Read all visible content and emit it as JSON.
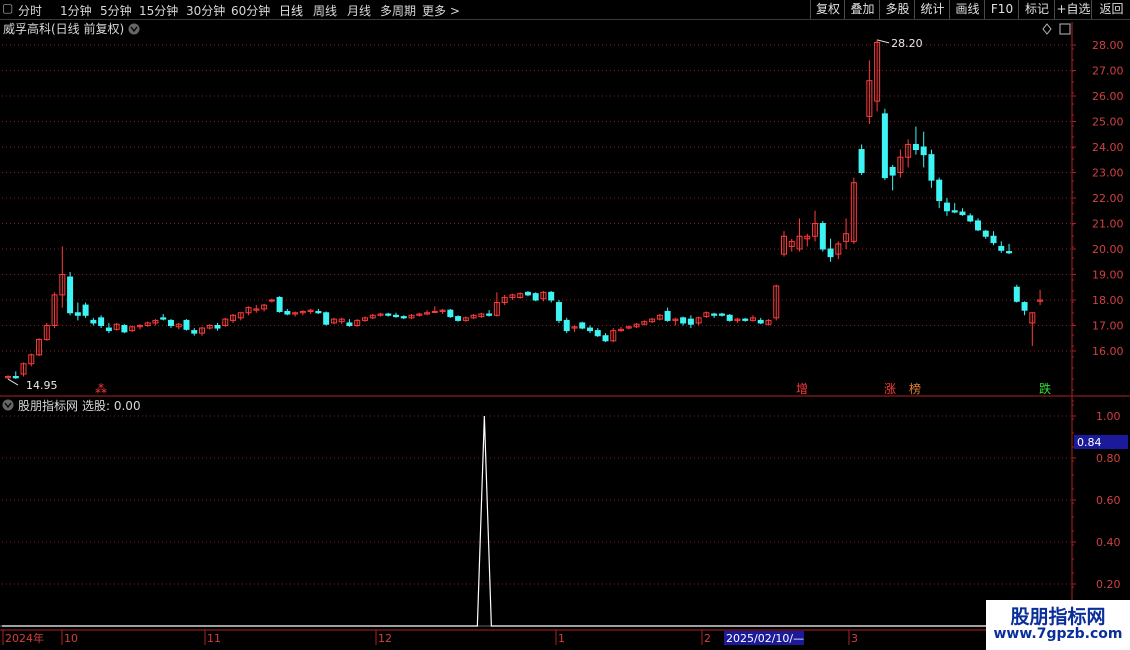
{
  "toolbar": {
    "left_items": [
      "分时",
      "1分钟",
      "5分钟",
      "15分钟",
      "30分钟",
      "60分钟",
      "日线",
      "周线",
      "月线",
      "多周期",
      "更多 >"
    ],
    "active_index": 6,
    "right_items": [
      "复权",
      "叠加",
      "多股",
      "统计",
      "画线",
      "F10",
      "标记",
      "+自选",
      "返回"
    ]
  },
  "stock": {
    "title": "威孚高科(日线 前复权)"
  },
  "indicator": {
    "title": "股朋指标网",
    "value_label": "选股: 0.00"
  },
  "price_axis": {
    "ticks": [
      "28.00",
      "27.00",
      "26.00",
      "25.00",
      "24.00",
      "23.00",
      "22.00",
      "21.00",
      "20.00",
      "19.00",
      "18.00",
      "17.00",
      "16.00"
    ]
  },
  "indicator_axis": {
    "ticks": [
      "1.00",
      "0.80",
      "0.60",
      "0.40",
      "0.20"
    ],
    "cursor_value": "0.84"
  },
  "annotations": {
    "high": "28.20",
    "low": "14.95"
  },
  "event_markers": [
    {
      "text": "⁂",
      "color": "#ff3b3b"
    },
    {
      "text": "增",
      "color": "#ff3b3b"
    },
    {
      "text": "涨",
      "color": "#ff3b3b"
    },
    {
      "text": "榜",
      "color": "#e08030"
    },
    {
      "text": "跌",
      "color": "#33dd33"
    }
  ],
  "date_axis": {
    "labels": [
      "2024年",
      "10",
      "11",
      "12",
      "1",
      "2",
      "3"
    ],
    "cursor_date": "2025/02/10/—"
  },
  "watermark": {
    "line1": "股朋指标网",
    "line2": "www.7gpzb.com"
  },
  "colors": {
    "up": "#ff3b3b",
    "down": "#3ef3f3",
    "grid": "#8a1c1c",
    "axis_text": "#d04040"
  },
  "chart_data": {
    "type": "candlestick",
    "candles": [
      [
        14.95,
        15.05,
        14.9,
        15.0
      ],
      [
        15.0,
        15.2,
        14.9,
        14.95
      ],
      [
        15.1,
        15.55,
        15.0,
        15.5
      ],
      [
        15.5,
        15.9,
        15.4,
        15.85
      ],
      [
        15.85,
        16.5,
        15.8,
        16.45
      ],
      [
        16.45,
        17.1,
        16.4,
        17.0
      ],
      [
        17.0,
        18.3,
        16.9,
        18.2
      ],
      [
        18.2,
        20.1,
        17.7,
        19.0
      ],
      [
        18.9,
        19.1,
        17.4,
        17.5
      ],
      [
        17.5,
        17.9,
        17.2,
        17.4
      ],
      [
        17.8,
        17.9,
        17.3,
        17.4
      ],
      [
        17.2,
        17.3,
        17.0,
        17.1
      ],
      [
        17.3,
        17.4,
        16.9,
        17.0
      ],
      [
        16.9,
        17.1,
        16.7,
        16.8
      ],
      [
        16.85,
        17.1,
        16.8,
        17.05
      ],
      [
        17.0,
        17.05,
        16.7,
        16.75
      ],
      [
        16.8,
        17.0,
        16.75,
        16.95
      ],
      [
        16.95,
        17.05,
        16.85,
        17.0
      ],
      [
        17.0,
        17.15,
        16.95,
        17.1
      ],
      [
        17.1,
        17.25,
        17.0,
        17.2
      ],
      [
        17.3,
        17.45,
        17.2,
        17.25
      ],
      [
        17.2,
        17.25,
        16.9,
        17.0
      ],
      [
        16.95,
        17.1,
        16.85,
        17.05
      ],
      [
        17.2,
        17.25,
        16.8,
        16.85
      ],
      [
        16.8,
        16.9,
        16.6,
        16.7
      ],
      [
        16.7,
        16.95,
        16.6,
        16.9
      ],
      [
        16.9,
        17.05,
        16.85,
        17.0
      ],
      [
        17.0,
        17.1,
        16.8,
        16.9
      ],
      [
        17.0,
        17.3,
        16.95,
        17.25
      ],
      [
        17.2,
        17.45,
        17.1,
        17.4
      ],
      [
        17.3,
        17.5,
        17.2,
        17.5
      ],
      [
        17.5,
        17.75,
        17.4,
        17.7
      ],
      [
        17.6,
        17.8,
        17.5,
        17.65
      ],
      [
        17.65,
        17.85,
        17.55,
        17.8
      ],
      [
        18.0,
        18.05,
        17.9,
        18.0
      ],
      [
        18.1,
        18.15,
        17.5,
        17.55
      ],
      [
        17.55,
        17.65,
        17.4,
        17.45
      ],
      [
        17.45,
        17.55,
        17.35,
        17.5
      ],
      [
        17.5,
        17.6,
        17.4,
        17.55
      ],
      [
        17.55,
        17.65,
        17.45,
        17.6
      ],
      [
        17.55,
        17.65,
        17.45,
        17.5
      ],
      [
        17.5,
        17.55,
        17.0,
        17.05
      ],
      [
        17.1,
        17.3,
        17.05,
        17.25
      ],
      [
        17.15,
        17.3,
        17.05,
        17.25
      ],
      [
        17.1,
        17.25,
        16.95,
        17.0
      ],
      [
        17.0,
        17.25,
        16.95,
        17.2
      ],
      [
        17.2,
        17.35,
        17.15,
        17.3
      ],
      [
        17.3,
        17.45,
        17.25,
        17.4
      ],
      [
        17.4,
        17.5,
        17.35,
        17.45
      ],
      [
        17.45,
        17.5,
        17.35,
        17.4
      ],
      [
        17.4,
        17.5,
        17.3,
        17.35
      ],
      [
        17.35,
        17.4,
        17.25,
        17.3
      ],
      [
        17.3,
        17.45,
        17.25,
        17.4
      ],
      [
        17.4,
        17.5,
        17.35,
        17.45
      ],
      [
        17.45,
        17.6,
        17.4,
        17.5
      ],
      [
        17.55,
        17.75,
        17.5,
        17.55
      ],
      [
        17.55,
        17.65,
        17.45,
        17.6
      ],
      [
        17.6,
        17.65,
        17.3,
        17.35
      ],
      [
        17.35,
        17.4,
        17.15,
        17.2
      ],
      [
        17.2,
        17.35,
        17.15,
        17.3
      ],
      [
        17.3,
        17.45,
        17.25,
        17.4
      ],
      [
        17.35,
        17.5,
        17.3,
        17.45
      ],
      [
        17.45,
        17.6,
        17.35,
        17.4
      ],
      [
        17.4,
        18.3,
        17.35,
        17.9
      ],
      [
        17.9,
        18.2,
        17.8,
        18.1
      ],
      [
        18.1,
        18.25,
        18.0,
        18.2
      ],
      [
        18.1,
        18.3,
        18.05,
        18.25
      ],
      [
        18.3,
        18.35,
        18.15,
        18.2
      ],
      [
        18.25,
        18.3,
        17.95,
        18.0
      ],
      [
        18.05,
        18.35,
        17.95,
        18.3
      ],
      [
        18.3,
        18.35,
        17.9,
        18.0
      ],
      [
        17.9,
        18.0,
        17.1,
        17.2
      ],
      [
        17.2,
        17.3,
        16.7,
        16.8
      ],
      [
        16.9,
        17.0,
        16.75,
        16.95
      ],
      [
        17.1,
        17.15,
        16.85,
        16.9
      ],
      [
        16.9,
        17.0,
        16.7,
        16.8
      ],
      [
        16.8,
        16.9,
        16.55,
        16.6
      ],
      [
        16.6,
        16.7,
        16.35,
        16.4
      ],
      [
        16.4,
        16.9,
        16.35,
        16.8
      ],
      [
        16.8,
        16.95,
        16.75,
        16.85
      ],
      [
        16.9,
        17.0,
        16.85,
        16.95
      ],
      [
        16.95,
        17.1,
        16.9,
        17.05
      ],
      [
        17.05,
        17.2,
        17.0,
        17.15
      ],
      [
        17.15,
        17.3,
        17.1,
        17.25
      ],
      [
        17.25,
        17.45,
        17.2,
        17.4
      ],
      [
        17.55,
        17.7,
        17.15,
        17.2
      ],
      [
        17.2,
        17.3,
        17.0,
        17.25
      ],
      [
        17.3,
        17.35,
        17.0,
        17.1
      ],
      [
        17.25,
        17.4,
        16.9,
        17.05
      ],
      [
        17.1,
        17.35,
        17.0,
        17.3
      ],
      [
        17.35,
        17.55,
        17.3,
        17.5
      ],
      [
        17.45,
        17.5,
        17.3,
        17.4
      ],
      [
        17.45,
        17.5,
        17.35,
        17.4
      ],
      [
        17.4,
        17.45,
        17.15,
        17.2
      ],
      [
        17.2,
        17.3,
        17.1,
        17.25
      ],
      [
        17.25,
        17.3,
        17.15,
        17.2
      ],
      [
        17.2,
        17.4,
        17.15,
        17.3
      ],
      [
        17.2,
        17.3,
        17.05,
        17.1
      ],
      [
        17.05,
        17.25,
        17.0,
        17.2
      ],
      [
        17.3,
        18.6,
        17.2,
        18.55
      ],
      [
        19.8,
        20.7,
        19.7,
        20.5
      ],
      [
        20.1,
        20.4,
        19.9,
        20.3
      ],
      [
        20.0,
        21.2,
        19.9,
        20.5
      ],
      [
        20.4,
        20.6,
        20.1,
        20.5
      ],
      [
        20.5,
        21.5,
        20.3,
        21.0
      ],
      [
        21.0,
        21.1,
        19.9,
        20.0
      ],
      [
        20.0,
        20.4,
        19.5,
        19.7
      ],
      [
        19.8,
        20.3,
        19.6,
        20.2
      ],
      [
        20.3,
        21.2,
        20.0,
        20.6
      ],
      [
        20.3,
        22.8,
        20.2,
        22.6
      ],
      [
        23.9,
        24.1,
        22.9,
        23.0
      ],
      [
        25.2,
        27.4,
        24.9,
        26.6
      ],
      [
        25.8,
        28.2,
        25.4,
        28.1
      ],
      [
        25.3,
        25.5,
        22.7,
        22.8
      ],
      [
        23.2,
        23.3,
        22.3,
        22.9
      ],
      [
        23.0,
        23.9,
        22.8,
        23.6
      ],
      [
        23.6,
        24.3,
        23.2,
        24.1
      ],
      [
        24.1,
        24.8,
        23.7,
        23.9
      ],
      [
        24.0,
        24.6,
        23.2,
        23.7
      ],
      [
        23.7,
        23.9,
        22.4,
        22.7
      ],
      [
        22.7,
        22.8,
        21.6,
        21.9
      ],
      [
        21.8,
        22.0,
        21.3,
        21.5
      ],
      [
        21.5,
        21.8,
        21.4,
        21.45
      ],
      [
        21.45,
        21.6,
        21.3,
        21.35
      ],
      [
        21.3,
        21.4,
        21.05,
        21.1
      ],
      [
        21.1,
        21.2,
        20.7,
        20.75
      ],
      [
        20.7,
        20.75,
        20.4,
        20.5
      ],
      [
        20.5,
        20.7,
        20.15,
        20.25
      ],
      [
        20.1,
        20.3,
        19.85,
        19.95
      ],
      [
        19.9,
        20.2,
        19.8,
        19.85
      ],
      [
        18.5,
        18.6,
        17.9,
        17.95
      ],
      [
        17.9,
        17.95,
        17.4,
        17.6
      ],
      [
        17.1,
        17.5,
        16.2,
        17.5
      ],
      [
        17.95,
        18.4,
        17.8,
        18.0
      ]
    ],
    "indicator_series": {
      "name": "选股",
      "spike_index": 61,
      "spike_value": 1.0
    },
    "y_range": [
      15.0,
      28.5
    ],
    "indicator_range": [
      0.0,
      1.1
    ]
  }
}
